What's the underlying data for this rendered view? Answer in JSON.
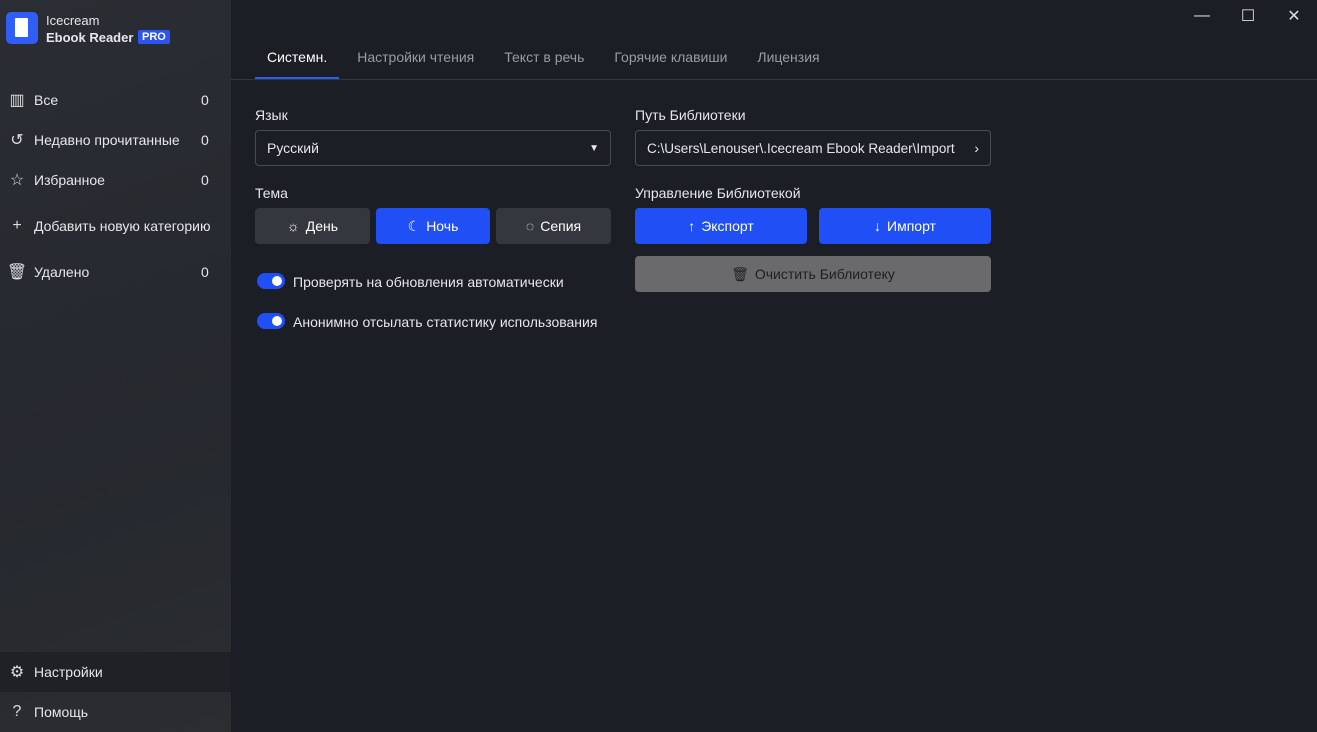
{
  "app": {
    "name_line1": "Icecream",
    "name_line2": "Ebook Reader",
    "badge": "PRO"
  },
  "sidebar": {
    "items": [
      {
        "label": "Все",
        "count": "0",
        "icon": "book-open-icon"
      },
      {
        "label": "Недавно прочитанные",
        "count": "0",
        "icon": "history-icon"
      },
      {
        "label": "Избранное",
        "count": "0",
        "icon": "star-icon"
      },
      {
        "label": "Добавить новую категорию",
        "count": "",
        "icon": "plus-icon"
      },
      {
        "label": "Удалено",
        "count": "0",
        "icon": "trash-icon"
      }
    ],
    "settings": "Настройки",
    "help": "Помощь"
  },
  "tabs": [
    "Системн.",
    "Настройки чтения",
    "Текст в речь",
    "Горячие клавиши",
    "Лицензия"
  ],
  "language": {
    "label": "Язык",
    "value": "Русский"
  },
  "theme": {
    "label": "Тема",
    "day": "День",
    "night": "Ночь",
    "sepia": "Сепия"
  },
  "toggles": [
    "Проверять на обновления автоматически",
    "Анонимно отсылать статистику использования"
  ],
  "library": {
    "path_label": "Путь Библиотеки",
    "path": "C:\\Users\\Lenouser\\.Icecream Ebook Reader\\Import",
    "manage_label": "Управление Библиотекой",
    "export": "Экспорт",
    "import": "Импорт",
    "clear": "Очистить Библиотеку"
  },
  "colors": {
    "accent": "#1f4ff5"
  }
}
